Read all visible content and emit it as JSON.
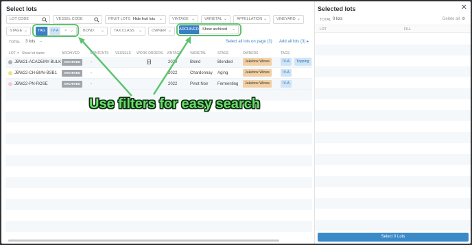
{
  "left": {
    "title": "Select lots",
    "filters": {
      "lot_code_placeholder": "LOT CODE",
      "vessel_code_placeholder": "VESSEL CODE",
      "fruit_lots_label": "FRUIT LOTS",
      "fruit_lots_value": "Hide fruit lots",
      "vintage_label": "VINTAGE",
      "varietal_label": "VARIETAL",
      "appellation_label": "APPELLATION",
      "vineyard_label": "VINEYARD",
      "stage_label": "STAGE",
      "tag_label": "TAG",
      "tag_value": "IV-A",
      "bond_label": "BOND",
      "tax_class_label": "TAX CLASS",
      "owner_label": "OWNER",
      "archived_label": "ARCHIVED",
      "archived_value": "Show archived"
    },
    "summary": {
      "total_label": "TOTAL",
      "total_value": "3 lots",
      "dash": "-",
      "select_page_link": "Select all lots on page (3)",
      "add_all_link": "Add all lots (3)"
    },
    "columns": {
      "lot": "LOT",
      "show_lot_name": "Show lot name",
      "archived": "ARCHIVED",
      "contents": "CONTENTS",
      "vessels": "VESSELS",
      "work_orders": "WORK ORDERS",
      "vintage": "VINTAGE",
      "varietal": "VARIETAL",
      "stage": "STAGE",
      "owners": "OWNERS",
      "tags": "TAGS"
    },
    "rows": [
      {
        "lot": "JBW21-ACADEMY-BULK",
        "archived": "ARCHIVED",
        "contents": "-",
        "vintage": "2020",
        "varietal": "Blend",
        "stage": "Blended",
        "owner": "Jukebox Wines",
        "tag": "IV-A",
        "tag2": "Topping",
        "dot_color": "#b0b0b0"
      },
      {
        "lot": "JBW22-CH-BMV-BSB1",
        "archived": "ARCHIVED",
        "contents": "-",
        "vintage": "2022",
        "varietal": "Chardonnay",
        "stage": "Aging",
        "owner": "Jukebox Wines",
        "tag": "IV-A",
        "tag2": "",
        "dot_color": "#f0e27a"
      },
      {
        "lot": "JBW22-PN-ROSE",
        "archived": "ARCHIVED",
        "contents": "-",
        "vintage": "2022",
        "varietal": "Pinot Noir",
        "stage": "Fermenting",
        "owner": "Jukebox Wines",
        "tag": "IV-A",
        "tag2": "",
        "dot_color": "#f4c9d6"
      }
    ],
    "annotation": "Use filters for easy search"
  },
  "right": {
    "title": "Selected lots",
    "total_label": "TOTAL",
    "total_value": "0 lots",
    "delete_all": "Delete all",
    "col_lot": "LOT",
    "col_fill": "FILL",
    "select_button": "Select 0 Lots"
  },
  "colors": {
    "accent_blue": "#3a7fc4",
    "highlight_green": "#5cc36e"
  }
}
